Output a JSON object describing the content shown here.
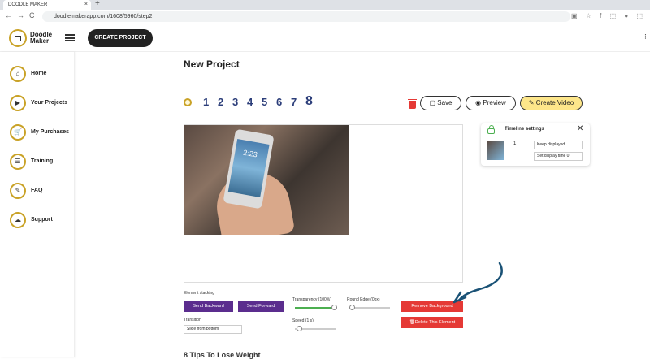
{
  "browser": {
    "tab_title": "DOODLE MAKER",
    "tab_close": "×",
    "new_tab": "+",
    "url": "doodlemakerapp.com/1608/5960/step2",
    "back": "←",
    "forward": "→",
    "reload": "C",
    "ext_icons": "▣ ☆ f ⬚ ● ⬚"
  },
  "header": {
    "logo_line1": "Doodle",
    "logo_line2": "Maker",
    "create_project": "CREATE PROJECT",
    "right_glyph": "⁝"
  },
  "sidebar": {
    "items": [
      {
        "label": "Home",
        "icon": "home-icon",
        "glyph": "⌂"
      },
      {
        "label": "Your Projects",
        "icon": "projects-icon",
        "glyph": "▶"
      },
      {
        "label": "My Purchases",
        "icon": "cart-icon",
        "glyph": "🛒"
      },
      {
        "label": "Training",
        "icon": "training-icon",
        "glyph": "☰"
      },
      {
        "label": "FAQ",
        "icon": "faq-icon",
        "glyph": "✎"
      },
      {
        "label": "Support",
        "icon": "support-icon",
        "glyph": "☁"
      }
    ]
  },
  "main": {
    "title": "New Project",
    "steps": [
      "1",
      "2",
      "3",
      "4",
      "5",
      "6",
      "7",
      "8"
    ],
    "save": "Save",
    "preview": "Preview",
    "create_video": "Create Video",
    "next_heading": "8 Tips To Lose Weight"
  },
  "canvas": {
    "phone_time": "2:23"
  },
  "timeline": {
    "title": "Timeline settings",
    "close": "✕",
    "item_number": "1",
    "keep_displayed": "Keep displayed",
    "set_display_time": "Set display time 0"
  },
  "controls": {
    "element_stacking": "Element stacking",
    "send_backward": "Send Backward",
    "send_forward": "Send Forward",
    "transparency": "Transparency (100%)",
    "transparency_value": 1.0,
    "round_edge": "Round Edge (0px)",
    "round_edge_value": 0,
    "remove_background": "Remove Background",
    "delete_element": "Delete This Element",
    "transition": "Transition",
    "transition_value": "Slide from bottom",
    "speed": "Speed (1 s)",
    "speed_value": 0.05
  },
  "colors": {
    "accent_gold": "#c9a227",
    "purple": "#5b2d8e",
    "red": "#e53935",
    "yellow_button": "#fde68a",
    "arrow": "#1a5276"
  }
}
